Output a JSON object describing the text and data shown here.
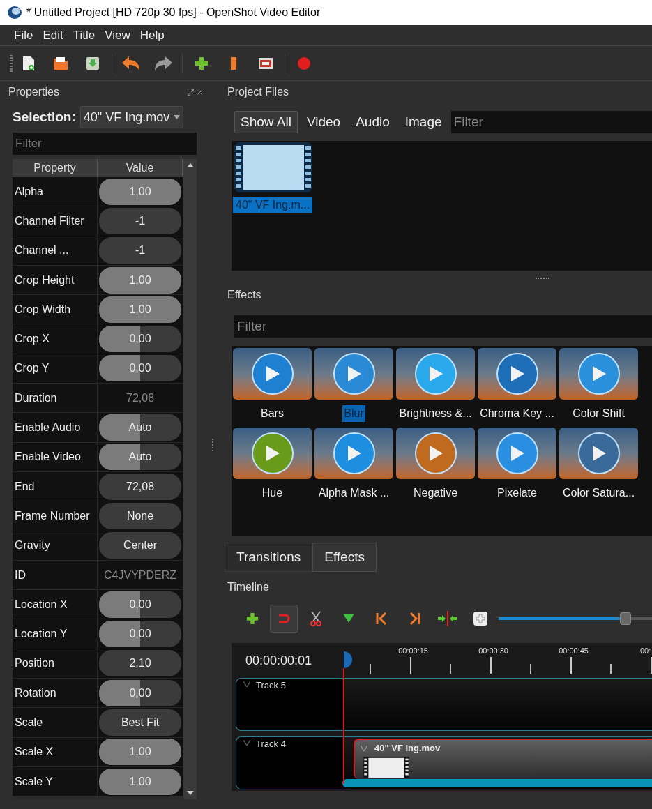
{
  "window": {
    "title": "* Untitled Project [HD 720p 30 fps] - OpenShot Video Editor"
  },
  "menu": [
    {
      "label": "File",
      "mnemonic": true
    },
    {
      "label": "Edit",
      "mnemonic": true
    },
    {
      "label": "Title",
      "mnemonic": false
    },
    {
      "label": "View",
      "mnemonic": false
    },
    {
      "label": "Help",
      "mnemonic": false
    }
  ],
  "properties": {
    "title": "Properties",
    "selection_label": "Selection:",
    "selection_value": "40\" VF Ing.mov",
    "filter_placeholder": "Filter",
    "columns": [
      "Property",
      "Value"
    ],
    "rows": [
      {
        "name": "Alpha",
        "value": "1,00",
        "kind": "slider",
        "level": 1
      },
      {
        "name": "Channel Filter",
        "value": "-1",
        "kind": "field"
      },
      {
        "name": "Channel ...",
        "value": "-1",
        "kind": "field"
      },
      {
        "name": "Crop Height",
        "value": "1,00",
        "kind": "slider",
        "level": 1
      },
      {
        "name": "Crop Width",
        "value": "1,00",
        "kind": "slider",
        "level": 1
      },
      {
        "name": "Crop X",
        "value": "0,00",
        "kind": "slider",
        "level": 0.5
      },
      {
        "name": "Crop Y",
        "value": "0,00",
        "kind": "slider",
        "level": 0.5
      },
      {
        "name": "Duration",
        "value": "72,08",
        "kind": "readonly"
      },
      {
        "name": "Enable Audio",
        "value": "Auto",
        "kind": "slider",
        "level": 0.5
      },
      {
        "name": "Enable Video",
        "value": "Auto",
        "kind": "slider",
        "level": 0.5
      },
      {
        "name": "End",
        "value": "72,08",
        "kind": "field"
      },
      {
        "name": "Frame Number",
        "value": "None",
        "kind": "field"
      },
      {
        "name": "Gravity",
        "value": "Center",
        "kind": "field"
      },
      {
        "name": "ID",
        "value": "C4JVYPDERZ",
        "kind": "readonly"
      },
      {
        "name": "Location X",
        "value": "0,00",
        "kind": "slider",
        "level": 0.5
      },
      {
        "name": "Location Y",
        "value": "0,00",
        "kind": "slider",
        "level": 0.5
      },
      {
        "name": "Position",
        "value": "2,10",
        "kind": "field"
      },
      {
        "name": "Rotation",
        "value": "0,00",
        "kind": "slider",
        "level": 0.5
      },
      {
        "name": "Scale",
        "value": "Best Fit",
        "kind": "field"
      },
      {
        "name": "Scale X",
        "value": "1,00",
        "kind": "slider",
        "level": 1
      },
      {
        "name": "Scale Y",
        "value": "1,00",
        "kind": "slider",
        "level": 1
      }
    ]
  },
  "project_files": {
    "title": "Project Files",
    "tabs": [
      {
        "label": "Show All",
        "selected": true
      },
      {
        "label": "Video",
        "selected": false
      },
      {
        "label": "Audio",
        "selected": false
      },
      {
        "label": "Image",
        "selected": false
      }
    ],
    "filter_placeholder": "Filter",
    "files": [
      {
        "name": "40\" VF Ing.m...",
        "selected": true
      }
    ]
  },
  "effects": {
    "title": "Effects",
    "filter_placeholder": "Filter",
    "items": [
      {
        "name": "Bars",
        "selected": false,
        "color": "#1f7fd0"
      },
      {
        "name": "Blur",
        "selected": true,
        "color": "#2b8ad6"
      },
      {
        "name": "Brightness &...",
        "selected": false,
        "color": "#2aa8ec"
      },
      {
        "name": "Chroma Key ...",
        "selected": false,
        "color": "#1f6fb8"
      },
      {
        "name": "Color Shift",
        "selected": false,
        "color": "#2a90dc"
      },
      {
        "name": "Hue",
        "selected": false,
        "color": "#6a9a1a"
      },
      {
        "name": "Alpha Mask ...",
        "selected": false,
        "color": "#1e8fe0"
      },
      {
        "name": "Negative",
        "selected": false,
        "color": "#c06a20"
      },
      {
        "name": "Pixelate",
        "selected": false,
        "color": "#2a8fe0"
      },
      {
        "name": "Color Satura...",
        "selected": false,
        "color": "#3a6a9a"
      }
    ]
  },
  "bottom_tabs": [
    {
      "label": "Transitions",
      "selected": false
    },
    {
      "label": "Effects",
      "selected": true
    }
  ],
  "timeline": {
    "title": "Timeline",
    "snapping_on": true,
    "zoom": {
      "level": 0.8
    },
    "timecode": "00:00:00:01",
    "ruler": [
      "00:00:15",
      "00:00:30",
      "00:00:45",
      "00:"
    ],
    "tracks": [
      {
        "name": "Track 5"
      },
      {
        "name": "Track 4",
        "clips": [
          {
            "name": "40\" VF Ing.mov",
            "selected": true
          }
        ]
      }
    ]
  }
}
